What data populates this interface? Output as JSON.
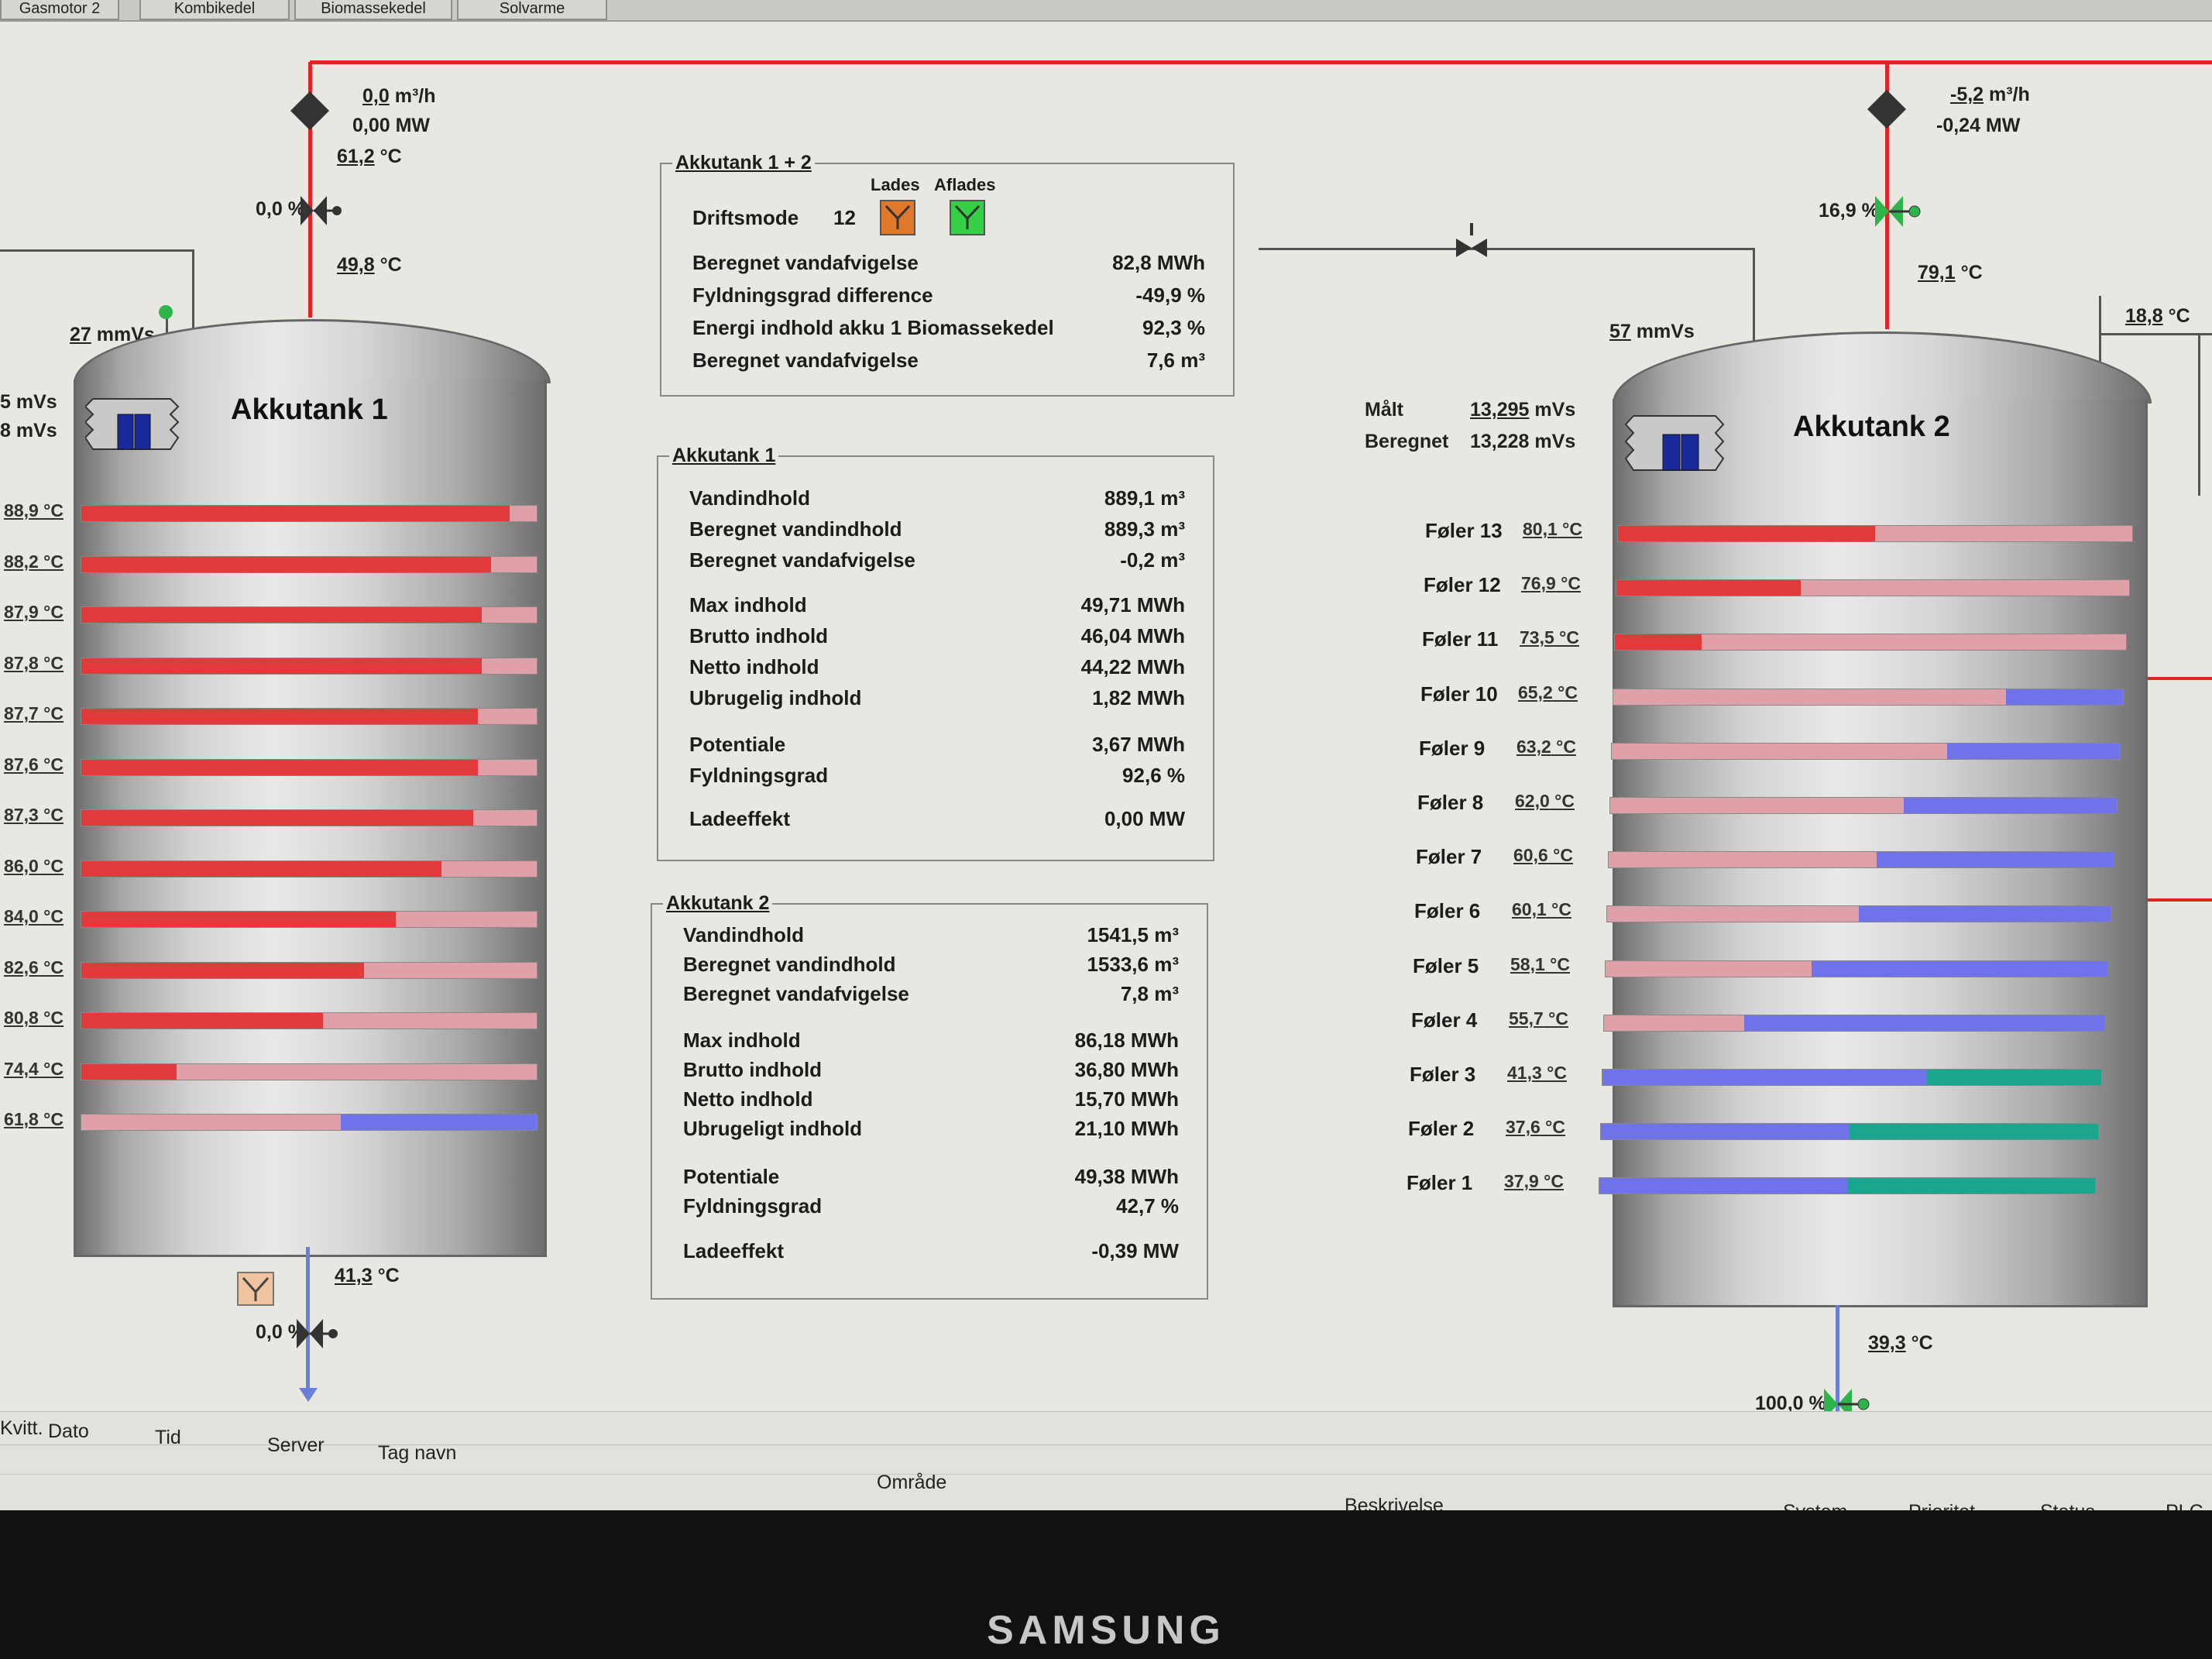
{
  "top_tabs": [
    "Gasmotor 2",
    "Kombikedel",
    "Biomassekedel",
    "Solvarme"
  ],
  "tank1": {
    "title": "Akkutank 1",
    "top_flow": "0,0",
    "top_flow_unit": "m³/h",
    "top_power": "0,00 MW",
    "top_temp": "61,2",
    "valve_top": "0,0 %",
    "riser_temp": "49,8",
    "level": "27",
    "level_unit": "mmVs",
    "left_readout_1": "5 mVs",
    "left_readout_2": "8 mVs",
    "bottom_temp": "41,3",
    "valve_bottom": "0,0 %",
    "bottom_icon": "tank-charge-icon",
    "layers": [
      {
        "temp": "88,9",
        "fill": [
          0.94,
          0.06,
          0
        ]
      },
      {
        "temp": "88,2",
        "fill": [
          0.9,
          0.1,
          0
        ]
      },
      {
        "temp": "87,9",
        "fill": [
          0.88,
          0.12,
          0
        ]
      },
      {
        "temp": "87,8",
        "fill": [
          0.88,
          0.12,
          0
        ]
      },
      {
        "temp": "87,7",
        "fill": [
          0.87,
          0.13,
          0
        ]
      },
      {
        "temp": "87,6",
        "fill": [
          0.87,
          0.13,
          0
        ]
      },
      {
        "temp": "87,3",
        "fill": [
          0.86,
          0.14,
          0
        ]
      },
      {
        "temp": "86,0",
        "fill": [
          0.79,
          0.21,
          0
        ]
      },
      {
        "temp": "84,0",
        "fill": [
          0.69,
          0.31,
          0
        ]
      },
      {
        "temp": "82,6",
        "fill": [
          0.62,
          0.38,
          0
        ]
      },
      {
        "temp": "80,8",
        "fill": [
          0.53,
          0.47,
          0
        ]
      },
      {
        "temp": "74,4",
        "fill": [
          0.21,
          0.79,
          0
        ]
      },
      {
        "temp": "61,8",
        "fill": [
          0,
          0.57,
          0.43
        ]
      }
    ]
  },
  "tank2": {
    "title": "Akkutank 2",
    "top_flow": "-5,2",
    "top_flow_unit": "m³/h",
    "top_power": "-0,24 MW",
    "valve_top": "16,9 %",
    "riser_temp": "79,1",
    "right_temp": "18,8",
    "level": "57",
    "level_unit": "mmVs",
    "maalt_label": "Målt",
    "maalt_value": "13,295",
    "beregnet_label": "Beregnet",
    "beregnet_value": "13,228",
    "pressure_unit": "mVs",
    "bottom_temp": "39,3",
    "valve_bottom": "100,0 %",
    "sensors": [
      {
        "label": "Føler 13",
        "temp": "80,1",
        "fill": [
          0.5,
          0.5,
          0,
          0
        ]
      },
      {
        "label": "Føler 12",
        "temp": "76,9",
        "fill": [
          0.36,
          0.64,
          0,
          0
        ]
      },
      {
        "label": "Føler 11",
        "temp": "73,5",
        "fill": [
          0.17,
          0.83,
          0,
          0
        ]
      },
      {
        "label": "Føler 10",
        "temp": "65,2",
        "fill": [
          0,
          0.77,
          0.23,
          0
        ]
      },
      {
        "label": "Føler 9",
        "temp": "63,2",
        "fill": [
          0,
          0.66,
          0.34,
          0
        ]
      },
      {
        "label": "Føler 8",
        "temp": "62,0",
        "fill": [
          0,
          0.58,
          0.42,
          0
        ]
      },
      {
        "label": "Føler 7",
        "temp": "60,6",
        "fill": [
          0,
          0.53,
          0.47,
          0
        ]
      },
      {
        "label": "Føler 6",
        "temp": "60,1",
        "fill": [
          0,
          0.5,
          0.5,
          0
        ]
      },
      {
        "label": "Føler 5",
        "temp": "58,1",
        "fill": [
          0,
          0.41,
          0.59,
          0
        ]
      },
      {
        "label": "Føler 4",
        "temp": "55,7",
        "fill": [
          0,
          0.28,
          0.72,
          0
        ]
      },
      {
        "label": "Føler 3",
        "temp": "41,3",
        "fill": [
          0,
          0,
          0.65,
          0.35
        ]
      },
      {
        "label": "Føler 2",
        "temp": "37,6",
        "fill": [
          0,
          0,
          0.5,
          0.5
        ]
      },
      {
        "label": "Føler 1",
        "temp": "37,9",
        "fill": [
          0,
          0,
          0.5,
          0.5
        ]
      }
    ]
  },
  "temp_unit": "°C",
  "panel_both": {
    "title": "Akkutank 1 + 2",
    "lades_label": "Lades",
    "aflades_label": "Aflades",
    "driftsmode_label": "Driftsmode",
    "driftsmode_value": "12",
    "rows": [
      {
        "label": "Beregnet vandafvigelse",
        "value": "82,8 MWh"
      },
      {
        "label": "Fyldningsgrad difference",
        "value": "-49,9 %"
      },
      {
        "label": "Energi indhold akku 1 Biomassekedel",
        "value": "92,3 %"
      },
      {
        "label": "Beregnet vandafvigelse",
        "value": "7,6 m³"
      }
    ]
  },
  "panel_tank1": {
    "title": "Akkutank 1",
    "rows": [
      {
        "label": "Vandindhold",
        "value": "889,1 m³"
      },
      {
        "label": "Beregnet vandindhold",
        "value": "889,3 m³"
      },
      {
        "label": "Beregnet vandafvigelse",
        "value": "-0,2 m³"
      },
      {
        "label": "Max indhold",
        "value": "49,71 MWh"
      },
      {
        "label": "Brutto indhold",
        "value": "46,04 MWh"
      },
      {
        "label": "Netto indhold",
        "value": "44,22 MWh"
      },
      {
        "label": "Ubrugelig indhold",
        "value": "1,82 MWh"
      },
      {
        "label": "Potentiale",
        "value": "3,67 MWh"
      },
      {
        "label": "Fyldningsgrad",
        "value": "92,6 %"
      },
      {
        "label": "Ladeeffekt",
        "value": "0,00 MW"
      }
    ]
  },
  "panel_tank2": {
    "title": "Akkutank 2",
    "rows": [
      {
        "label": "Vandindhold",
        "value": "1541,5 m³"
      },
      {
        "label": "Beregnet vandindhold",
        "value": "1533,6 m³"
      },
      {
        "label": "Beregnet vandafvigelse",
        "value": "7,8 m³"
      },
      {
        "label": "Max indhold",
        "value": "86,18 MWh"
      },
      {
        "label": "Brutto indhold",
        "value": "36,80 MWh"
      },
      {
        "label": "Netto indhold",
        "value": "15,70 MWh"
      },
      {
        "label": "Ubrugeligt indhold",
        "value": "21,10 MWh"
      },
      {
        "label": "Potentiale",
        "value": "49,38 MWh"
      },
      {
        "label": "Fyldningsgrad",
        "value": "42,7 %"
      },
      {
        "label": "Ladeeffekt",
        "value": "-0,39 MW"
      }
    ]
  },
  "alarm_columns": [
    "Kvitt.",
    "Dato",
    "Tid",
    "Server",
    "Tag navn",
    "Område",
    "Beskrivelse",
    "System",
    "Prioritet",
    "Status",
    "PLC"
  ],
  "monitor_brand": "SAMSUNG",
  "colors": {
    "hot": "#e23a3a",
    "warm": "#e0a0a8",
    "cool": "#6f72e8",
    "cold": "#1aa58e",
    "pipe_hot": "#e02424",
    "pipe_cold": "#6a7fd6",
    "valve_open": "#2fb44b"
  }
}
